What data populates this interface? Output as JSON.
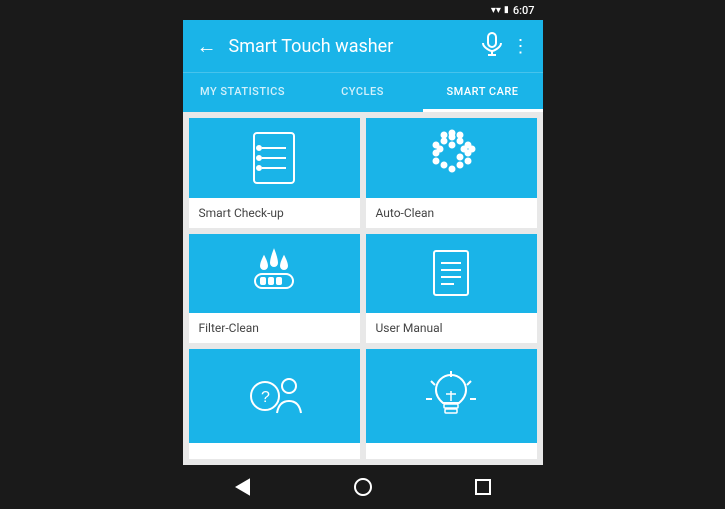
{
  "statusBar": {
    "time": "6:07"
  },
  "appBar": {
    "title": "Smart Touch washer",
    "backLabel": "←",
    "micLabel": "🎤",
    "moreLabel": "⋮"
  },
  "tabs": [
    {
      "id": "my-statistics",
      "label": "MY STATISTICS",
      "active": false
    },
    {
      "id": "cycles",
      "label": "CYCLES",
      "active": false
    },
    {
      "id": "smart-care",
      "label": "SMART CARE",
      "active": true
    }
  ],
  "cards": [
    {
      "id": "smart-checkup",
      "label": "Smart Check-up",
      "icon": "checklist"
    },
    {
      "id": "auto-clean",
      "label": "Auto-Clean",
      "icon": "spray"
    },
    {
      "id": "filter-clean",
      "label": "Filter-Clean",
      "icon": "filter"
    },
    {
      "id": "user-manual",
      "label": "User Manual",
      "icon": "document"
    },
    {
      "id": "help",
      "label": "",
      "icon": "help-person"
    },
    {
      "id": "tips",
      "label": "",
      "icon": "lightbulb"
    }
  ],
  "bottomNav": {
    "backLabel": "◁",
    "homeLabel": "",
    "recentLabel": ""
  }
}
